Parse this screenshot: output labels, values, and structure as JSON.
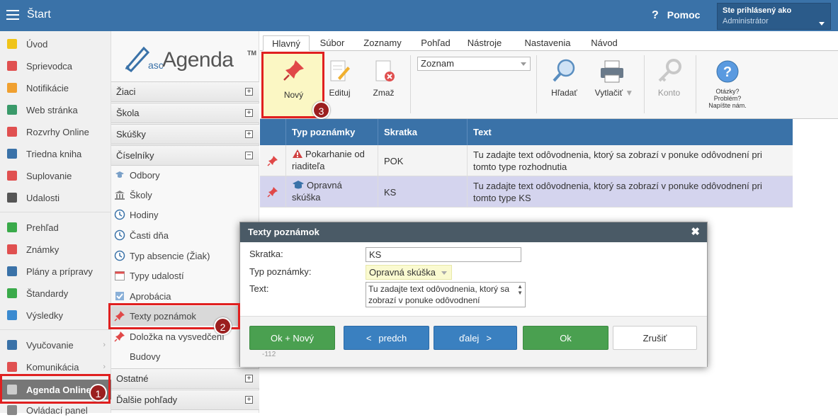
{
  "topbar": {
    "title": "Štart",
    "help": "Pomoc",
    "user_label": "Ste prihlásený ako",
    "user_name": "Administrátor"
  },
  "leftnav": {
    "items": [
      {
        "label": "Úvod",
        "color": "#f0c419"
      },
      {
        "label": "Sprievodca",
        "color": "#e05050"
      },
      {
        "label": "Notifikácie",
        "color": "#f0a030"
      },
      {
        "label": "Web stránka",
        "color": "#3a9a6a"
      },
      {
        "label": "Rozvrhy Online",
        "color": "#e05050"
      },
      {
        "label": "Triedna kniha",
        "color": "#3a72a8"
      },
      {
        "label": "Suplovanie",
        "color": "#e05050"
      },
      {
        "label": "Udalosti",
        "color": "#555555"
      },
      {
        "label": "Prehľad",
        "color": "#3aaa4a"
      },
      {
        "label": "Známky",
        "color": "#e05050"
      },
      {
        "label": "Plány a prípravy",
        "color": "#3a72a8"
      },
      {
        "label": "Štandardy",
        "color": "#3aaa4a"
      },
      {
        "label": "Výsledky",
        "color": "#3a8ad0"
      },
      {
        "label": "Vyučovanie",
        "color": "#3a72a8"
      },
      {
        "label": "Komunikácia",
        "color": "#e05050"
      },
      {
        "label": "Agenda Online",
        "color": "#cccccc"
      },
      {
        "label": "Ovládací panel",
        "color": "#888888"
      }
    ]
  },
  "logo": {
    "prefix": "asc",
    "name": "Agenda",
    "tm": "TM"
  },
  "subnav": {
    "sections": [
      "Žiaci",
      "Škola",
      "Skúšky",
      "Číselníky",
      "Ostatné",
      "Ďalšie pohľady"
    ],
    "items": [
      "Odbory",
      "Školy",
      "Hodiny",
      "Časti dňa",
      "Typ absencie (Žiak)",
      "Typy udalostí",
      "Aprobácia",
      "Texty poznámok",
      "Doložka na vysvedčení",
      "Budovy"
    ]
  },
  "ribbon": {
    "tabs": [
      "Hlavný",
      "Súbor",
      "Zoznamy",
      "Pohľad",
      "Nástroje",
      "Nastavenia",
      "Návod"
    ],
    "buttons": {
      "new": "Nový",
      "edit": "Edituj",
      "delete": "Zmaž",
      "search": "Hľadať",
      "print": "Vytlačiť",
      "account": "Konto"
    },
    "view_select": "Zoznam",
    "help_text": [
      "Otázky?",
      "Problém?",
      "Napíšte nám."
    ]
  },
  "table": {
    "headers": [
      "Typ poznámky",
      "Skratka",
      "Text"
    ],
    "rows": [
      {
        "type": "Pokarhanie od riaditeľa",
        "abbr": "POK",
        "text": "Tu zadajte text odôvodnenia, ktorý sa zobrazí v ponuke odôvodnení pri tomto type rozhodnutia"
      },
      {
        "type": "Opravná skúška",
        "abbr": "KS",
        "text": "Tu zadajte text odôvodnenia, ktorý sa zobrazí v ponuke odôvodnení pri tomto type KS"
      }
    ]
  },
  "dialog": {
    "title": "Texty poznámok",
    "fields": {
      "abbr_label": "Skratka:",
      "abbr_value": "KS",
      "type_label": "Typ poznámky:",
      "type_value": "Opravná skúška",
      "text_label": "Text:",
      "text_value": "Tu zadajte text odôvodnenia, ktorý sa zobrazí v ponuke odôvodnení"
    },
    "buttons": {
      "ok_new": "Ok + Nový",
      "prev": "predch",
      "next": "ďalej",
      "ok": "Ok",
      "cancel": "Zrušiť"
    },
    "id": "-112"
  },
  "badges": [
    "1",
    "2",
    "3"
  ]
}
